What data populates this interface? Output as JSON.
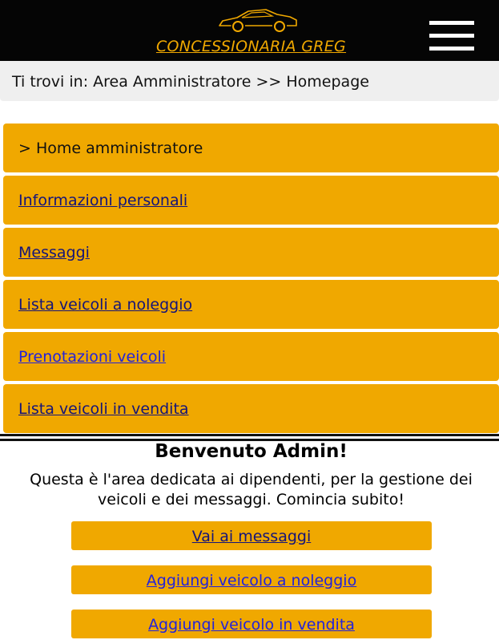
{
  "header": {
    "brand": "CONCESSIONARIA GREG",
    "logo_icon": "sports-car-icon",
    "menu_icon": "hamburger-menu-icon",
    "background_color": "#050505",
    "accent_color": "#f0a800"
  },
  "breadcrumb": {
    "text": "Ti trovi in: Area Amministratore >> Homepage"
  },
  "nav": {
    "current": "> Home amministratore",
    "items": [
      {
        "label": "Informazioni personali"
      },
      {
        "label": "Messaggi"
      },
      {
        "label": "Lista veicoli a noleggio"
      },
      {
        "label": "Prenotazioni veicoli"
      },
      {
        "label": "Lista veicoli in vendita"
      }
    ]
  },
  "main": {
    "title": "Benvenuto Admin!",
    "description": "Questa è l'area dedicata ai dipendenti, per la gestione dei veicoli e dei messaggi. Comincia subito!",
    "buttons": [
      {
        "label": "Vai ai messaggi"
      },
      {
        "label": "Aggiungi veicolo a noleggio"
      },
      {
        "label": "Aggiungi veicolo in vendita"
      }
    ]
  }
}
